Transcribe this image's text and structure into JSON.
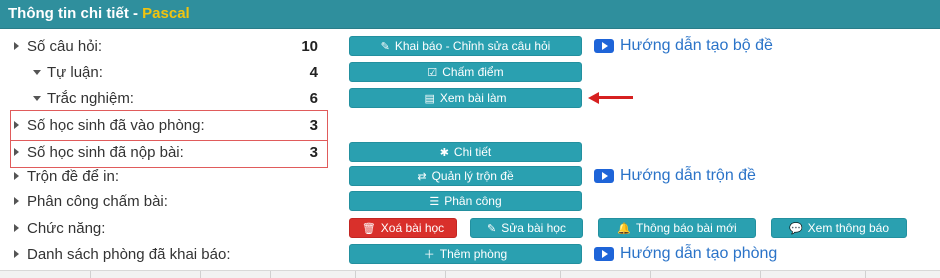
{
  "header": {
    "title": "Thông tin chi tiết",
    "separator": " - ",
    "subject": "Pascal"
  },
  "rows": [
    {
      "label": "Số câu hỏi:",
      "count": "10",
      "button": {
        "icon": "edit-icon",
        "label": "Khai báo - Chỉnh sửa câu hỏi"
      },
      "link": "Hướng dẫn tạo bộ đề"
    },
    {
      "label": "Tự luận:",
      "count": "4",
      "button": {
        "icon": "check-square-icon",
        "label": "Chấm điểm"
      }
    },
    {
      "label": "Trắc nghiệm:",
      "count": "6",
      "button": {
        "icon": "document-icon",
        "label": "Xem bài làm"
      }
    },
    {
      "label": "Số học sinh đã vào phòng:",
      "count": "3"
    },
    {
      "label": "Số học sinh đã nộp bài:",
      "count": "3",
      "button": {
        "icon": "asterisk-icon",
        "label": "Chi tiết"
      }
    },
    {
      "label": "Trộn đề để in:",
      "button": {
        "icon": "shuffle-icon",
        "label": "Quản lý trộn đề"
      },
      "link": "Hướng dẫn trộn đề"
    },
    {
      "label": "Phân công chấm bài:",
      "button": {
        "icon": "list-icon",
        "label": "Phân công"
      }
    },
    {
      "label": "Chức năng:",
      "buttons": [
        {
          "icon": "trash-icon",
          "label": "Xoá bài học",
          "color": "#d9302b"
        },
        {
          "icon": "edit-icon",
          "label": "Sửa bài học"
        },
        {
          "icon": "bell-icon",
          "label": "Thông báo bài mới"
        },
        {
          "icon": "chat-icon",
          "label": "Xem thông báo"
        }
      ]
    },
    {
      "label": "Danh sách phòng đã khai báo:",
      "button": {
        "icon": "plus-icon",
        "label": "Thêm phòng"
      },
      "link": "Hướng dẫn tạo phòng"
    }
  ],
  "colors": {
    "header": "#2f8f9d",
    "button": "#2aa0b0",
    "danger": "#d9302b",
    "link": "#2a73c8",
    "accent": "#f1c40f",
    "highlight": "#d62020"
  }
}
